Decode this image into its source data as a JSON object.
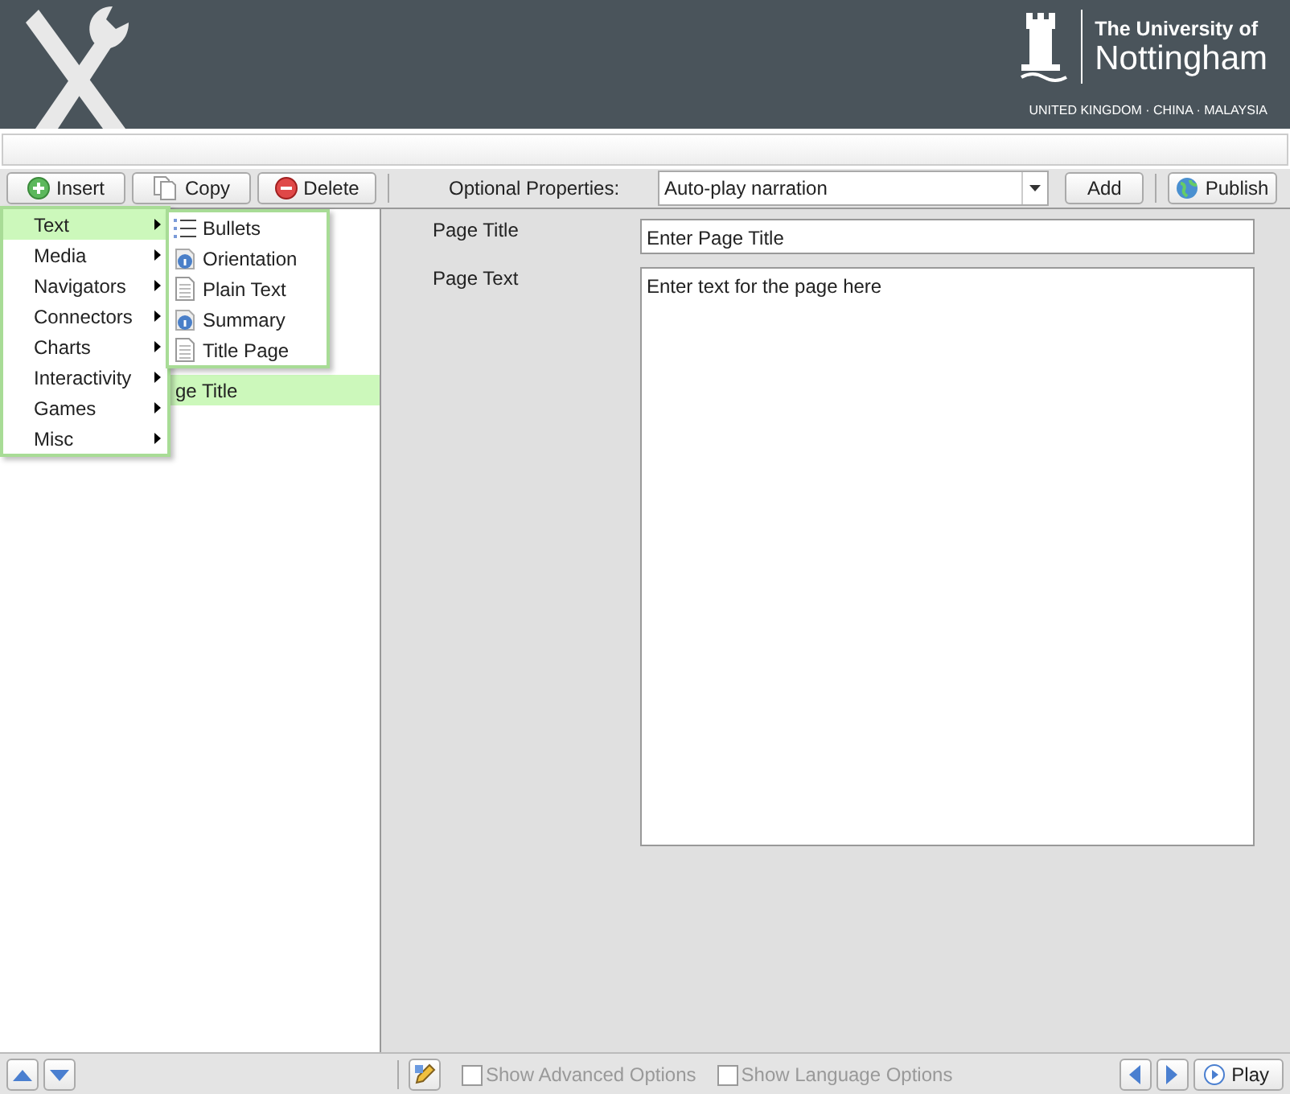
{
  "header": {
    "university_line1": "The University of",
    "university_line2": "Nottingham",
    "campuses": "UNITED KINGDOM · CHINA · MALAYSIA"
  },
  "toolbar": {
    "buttons": [
      {
        "label": "Insert",
        "kind": "insert"
      },
      {
        "label": "Copy",
        "kind": "copy"
      },
      {
        "label": "Delete",
        "kind": "delete"
      }
    ],
    "optional_properties_label": "Optional Properties:",
    "optional_properties_value": "Auto-play narration",
    "add_button": "Add",
    "publish_button": "Publish"
  },
  "tree": {
    "items": [
      {
        "label": "ge Title",
        "selected": true
      }
    ]
  },
  "insert_menu": {
    "items": [
      {
        "label": "Text",
        "selected": true
      },
      {
        "label": "Media",
        "selected": false
      },
      {
        "label": "Navigators",
        "selected": false
      },
      {
        "label": "Connectors",
        "selected": false
      },
      {
        "label": "Charts",
        "selected": false
      },
      {
        "label": "Interactivity",
        "selected": false
      },
      {
        "label": "Games",
        "selected": false
      },
      {
        "label": "Misc",
        "selected": false
      }
    ],
    "submenu": [
      {
        "label": "Bullets",
        "kind": "list"
      },
      {
        "label": "Orientation",
        "kind": "info"
      },
      {
        "label": "Plain Text",
        "kind": "document"
      },
      {
        "label": "Summary",
        "kind": "info"
      },
      {
        "label": "Title Page",
        "kind": "document"
      }
    ]
  },
  "form": {
    "fields": [
      {
        "label": "Page Title",
        "value": "Enter Page Title",
        "kind": "line"
      },
      {
        "label": "Page Text",
        "value": "Enter text for the page here",
        "kind": "area"
      }
    ]
  },
  "bottom_bar": {
    "options": [
      {
        "label": "Show Advanced Options",
        "checked": false,
        "disabled": true
      },
      {
        "label": "Show Language Options",
        "checked": false,
        "disabled": true
      }
    ],
    "play_button": "Play"
  }
}
